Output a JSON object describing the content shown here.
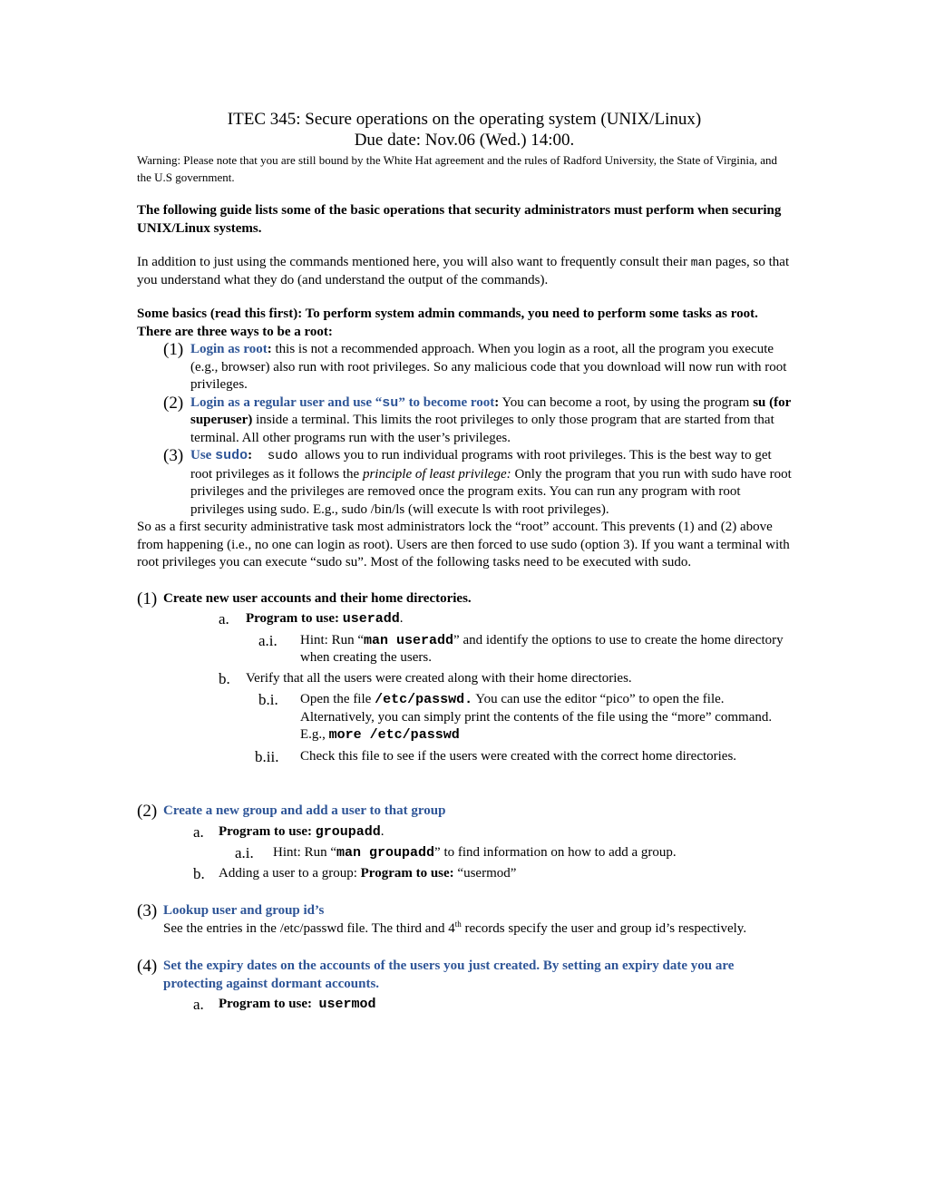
{
  "header": {
    "title": "ITEC 345: Secure operations on the operating system (UNIX/Linux)",
    "due_date": "Due date: Nov.06 (Wed.) 14:00.",
    "warning": "Warning: Please note that you are still bound by the White Hat agreement and the rules of Radford University, the State of Virginia, and the U.S government."
  },
  "intro": {
    "bold_text": "The following guide lists some of the basic operations that security administrators must perform when securing UNIX/Linux systems.",
    "para_pre": "In addition to just using the commands mentioned here, you will also want to frequently consult their ",
    "para_code": "man",
    "para_post": " pages, so that you understand what they do (and understand the output of the commands)."
  },
  "basics": {
    "heading": "Some basics (read this first):  To perform system admin commands, you need to perform some tasks as root. There are three ways to be a root:",
    "items": [
      {
        "num": "(1)",
        "label": "Login as root",
        "colon": ":",
        "text": " this is not a recommended approach. When you login as a root, all the program you execute (e.g., browser) also run with root privileges. So any malicious code that you download will now run with root privileges."
      },
      {
        "num": "(2)",
        "label_pre": "Login as a regular user and use “",
        "label_code": "su",
        "label_post": "” to become root",
        "colon": ":",
        "text_pre": " You can become a root, by using the program ",
        "text_bold": "su (for superuser)",
        "text_post": " inside a terminal. This limits the root privileges to only those program that are started from that terminal. All other programs run with the user’s privileges."
      },
      {
        "num": "(3)",
        "label_pre": "Use ",
        "label_code": "sudo",
        "colon": ":",
        "code": "  sudo",
        "text_pre": "  allows you to run individual programs with root privileges. This is the best way to get root privileges as it follows the ",
        "text_italic": "principle of least privilege:",
        "text_post": " Only the program that you run with sudo have root privileges and the privileges are removed once the program exits. You can run any program with root privileges using sudo. E.g., sudo /bin/ls (will execute ls with root privileges)."
      }
    ],
    "summary": "So as a first security administrative task most administrators lock the “root” account. This prevents (1) and (2) above from happening (i.e., no one can login as root). Users are then forced to use sudo (option 3). If you want a terminal with root privileges you can execute “sudo su”. Most of the following tasks need to be executed with sudo."
  },
  "tasks": [
    {
      "num": "(1)",
      "title": "Create new user accounts and their home directories.",
      "a_label": "a.",
      "a_pre": "Program to use: ",
      "a_code": "useradd",
      "a_post": ".",
      "ai_label": "a.i.",
      "ai_pre": "Hint: Run “",
      "ai_code": "man useradd",
      "ai_post": "” and identify the options to use to create the home directory when creating the users.",
      "b_label": "b.",
      "b_text": "Verify that all the users were created along with their home directories.",
      "bi_label": "b.i.",
      "bi_pre": "Open the file ",
      "bi_code": "/etc/passwd.",
      "bi_mid": " You can use the editor “pico” to open the file. Alternatively, you can simply print the contents of the file using the “more” command. E.g., ",
      "bi_code2": "more /etc/passwd",
      "bii_label": "b.ii.",
      "bii_text": "Check this file to see if the users were created with the correct home directories."
    },
    {
      "num": "(2)",
      "title": "Create a new group and add a user to that group",
      "a_label": "a.",
      "a_pre": "Program to use: ",
      "a_code": "groupadd",
      "a_post": ".",
      "ai_label": "a.i.",
      "ai_pre": "Hint: Run “",
      "ai_code": "man groupadd",
      "ai_post": "” to find information on how to add a group.",
      "b_label": "b.",
      "b_pre": "Adding a user to a group: ",
      "b_bold": "Program to use:",
      "b_post": " “usermod”"
    },
    {
      "num": "(3)",
      "title": "Lookup user and group id’s",
      "text_pre": "See the entries in the /etc/passwd file. The third and 4",
      "text_sup": "th",
      "text_post": " records specify the user and group id’s respectively."
    },
    {
      "num": "(4)",
      "title": "Set the expiry dates on the accounts of the users you just created. By setting an expiry date you are protecting against dormant accounts.",
      "a_label": "a.",
      "a_pre": "Program to use:  ",
      "a_code": "usermod"
    }
  ],
  "colors": {
    "heading_blue": "#2e5597",
    "text": "#000000"
  }
}
